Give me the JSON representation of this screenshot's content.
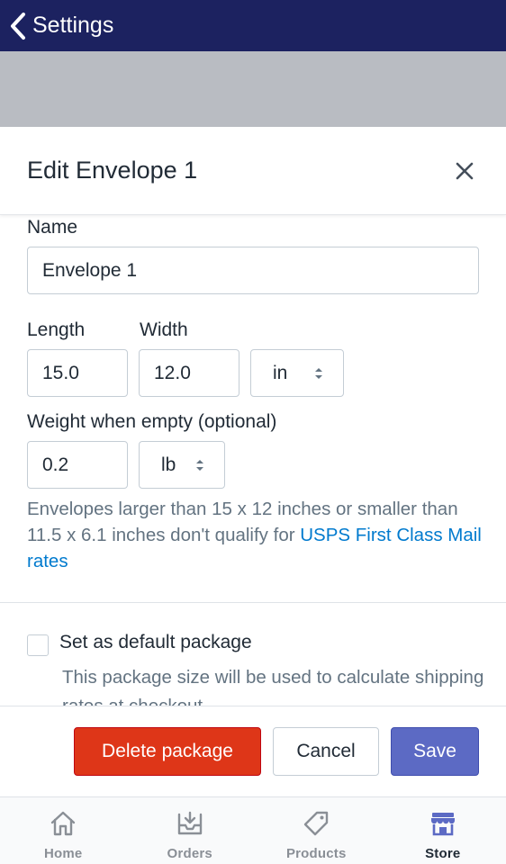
{
  "nav": {
    "back_label": "Settings"
  },
  "modal": {
    "title": "Edit Envelope 1",
    "name_label": "Name",
    "name_value": "Envelope 1",
    "length_label": "Length",
    "length_value": "15.0",
    "width_label": "Width",
    "width_value": "12.0",
    "dimension_unit": "in",
    "weight_label": "Weight when empty (optional)",
    "weight_value": "0.2",
    "weight_unit": "lb",
    "help_text": "Envelopes larger than 15 x 12 inches or smaller than 11.5 x 6.1 inches don't qualify for ",
    "help_link": "USPS First Class Mail rates",
    "default_label": "Set as default package",
    "default_help": "This package size will be used to calculate shipping rates at checkout",
    "default_checked": false
  },
  "footer": {
    "delete_label": "Delete package",
    "cancel_label": "Cancel",
    "save_label": "Save"
  },
  "tabs": [
    {
      "label": "Home",
      "icon": "home-icon",
      "active": false
    },
    {
      "label": "Orders",
      "icon": "orders-inbox-icon",
      "active": false
    },
    {
      "label": "Products",
      "icon": "tag-icon",
      "active": false
    },
    {
      "label": "Store",
      "icon": "store-icon",
      "active": true
    }
  ],
  "colors": {
    "nav_bg": "#1c2260",
    "delete": "#de3618",
    "save": "#5c6ac4",
    "link": "#007ace"
  }
}
